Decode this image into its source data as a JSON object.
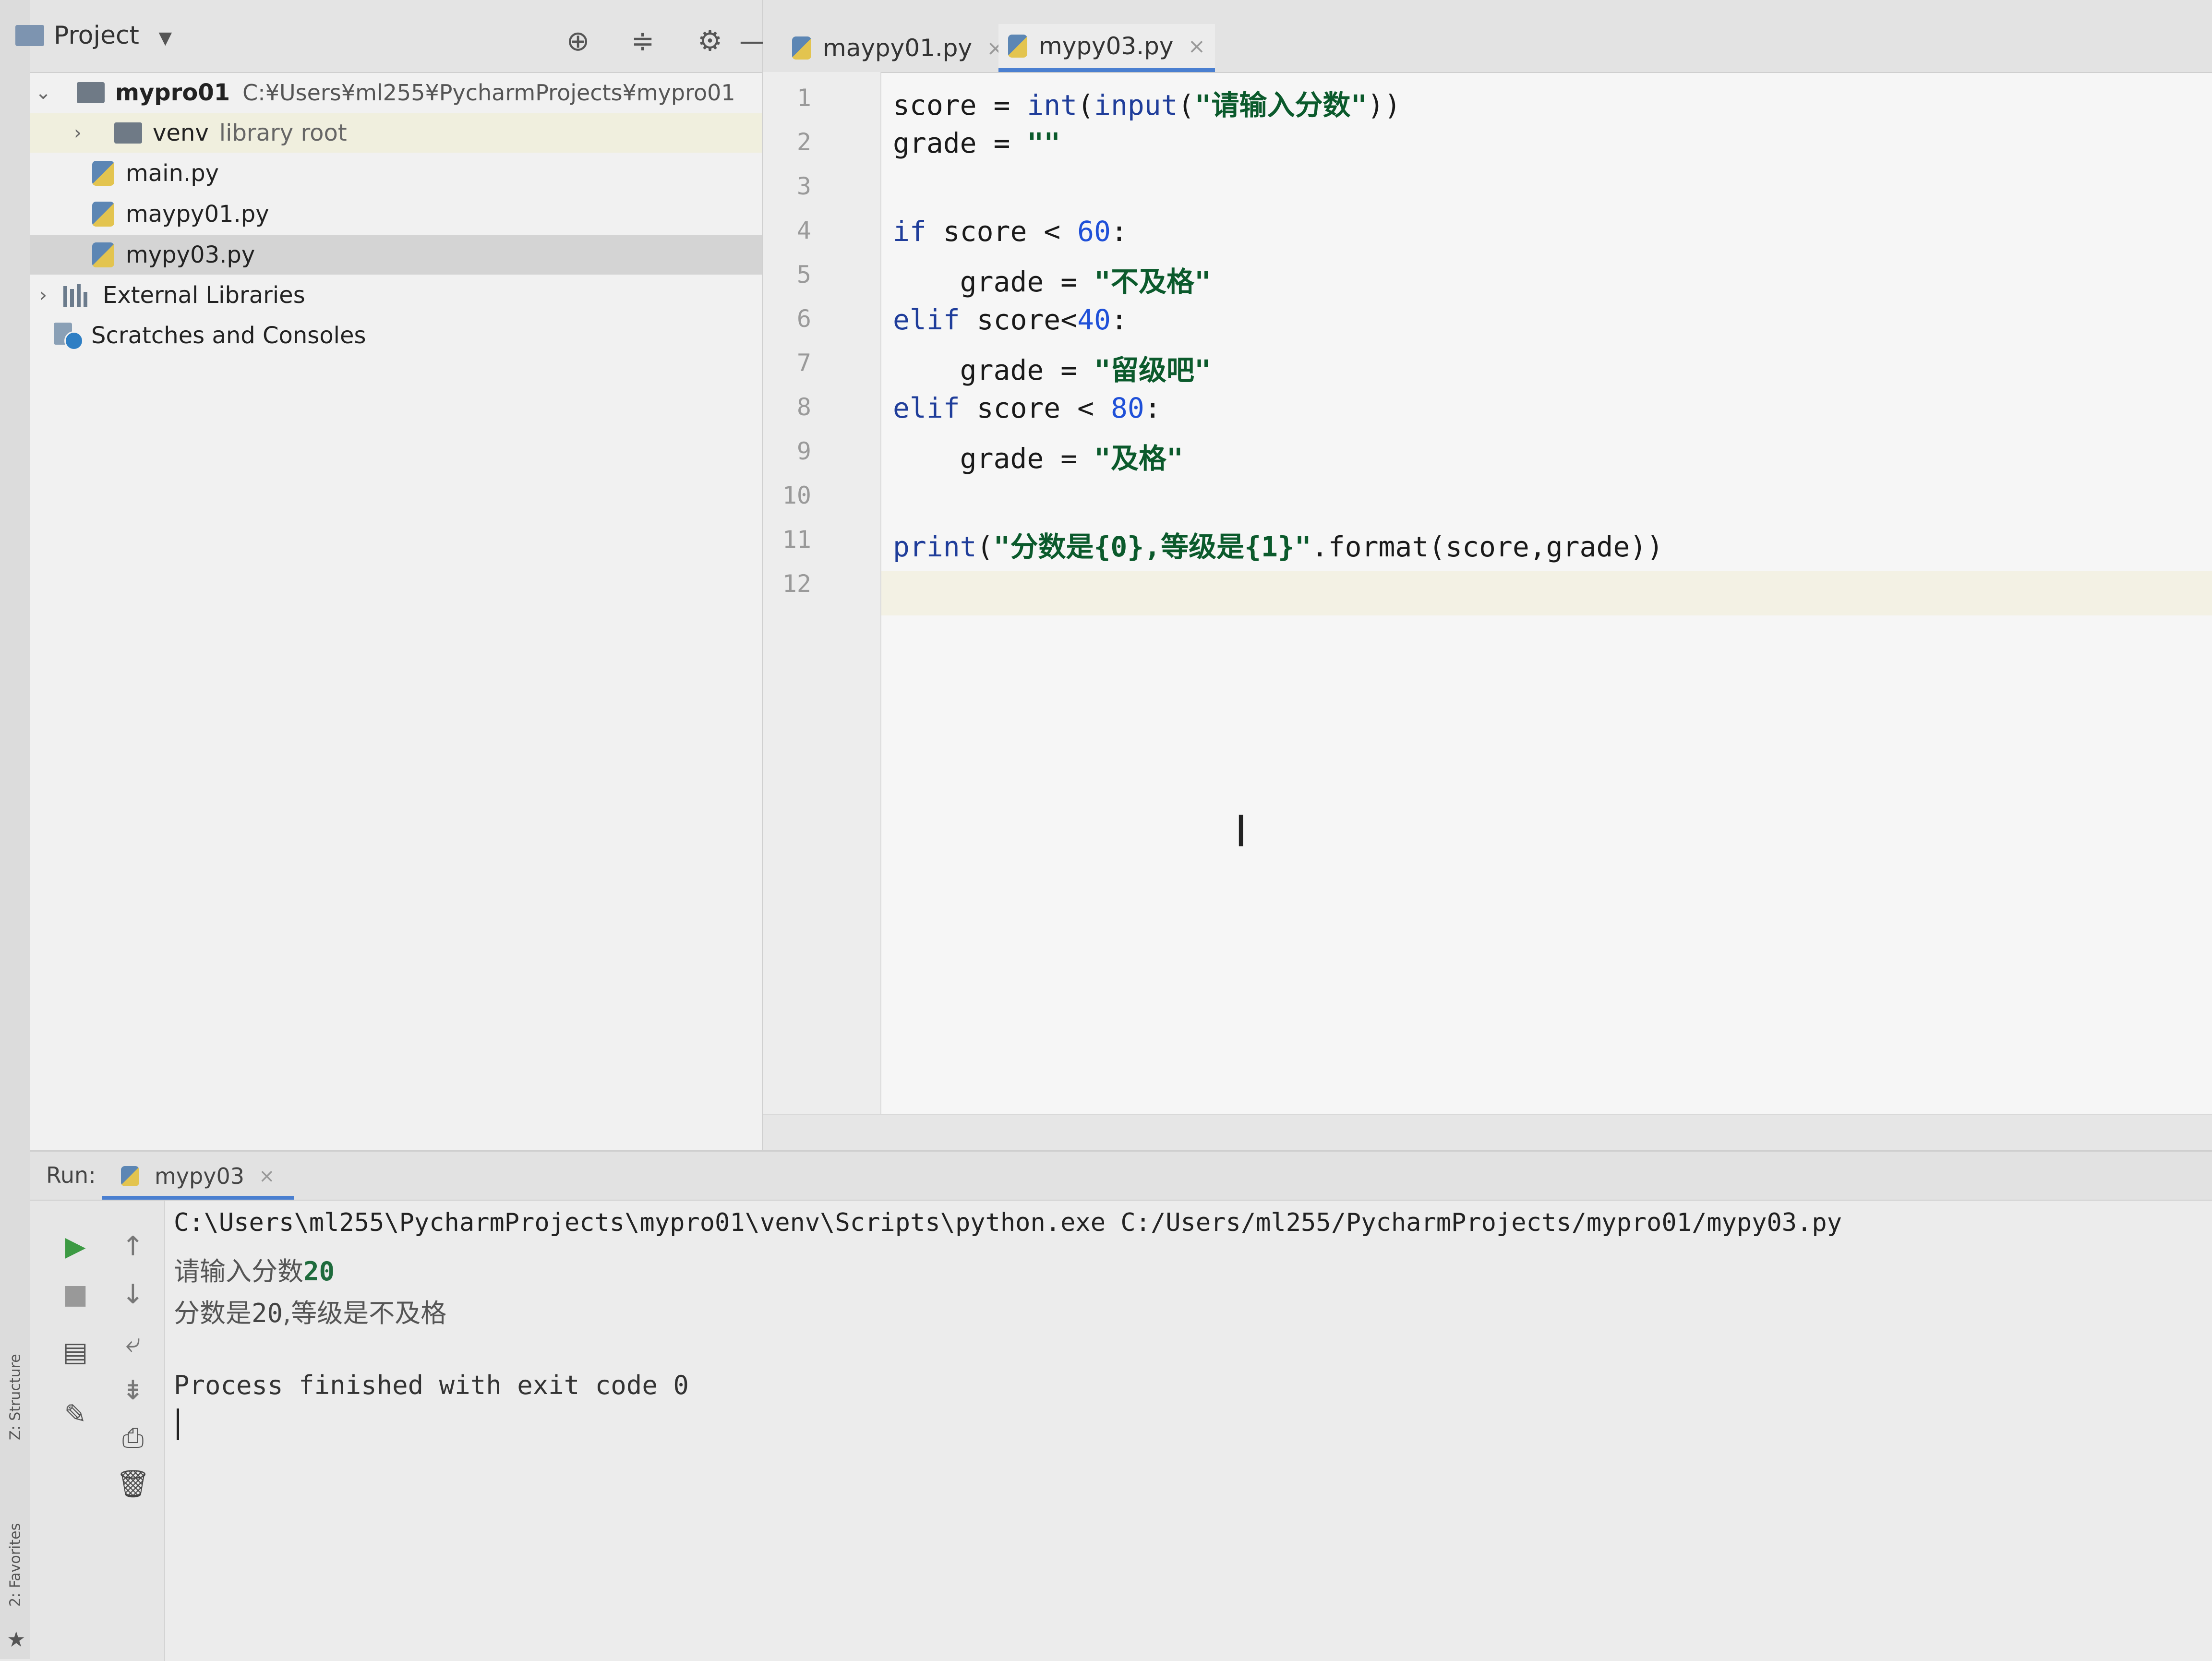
{
  "project_panel": {
    "title": "Project",
    "tree": [
      {
        "name": "mypro01",
        "path": "C:¥Users¥ml255¥PycharmProjects¥mypro01"
      },
      {
        "name": "venv",
        "note": "library root"
      },
      {
        "name": "main.py"
      },
      {
        "name": "maypy01.py"
      },
      {
        "name": "mypy03.py"
      },
      {
        "name": "External Libraries"
      },
      {
        "name": "Scratches and Consoles"
      }
    ]
  },
  "editor": {
    "tabs": [
      {
        "label": "maypy01.py"
      },
      {
        "label": "mypy03.py"
      }
    ],
    "line_numbers": [
      "1",
      "2",
      "3",
      "4",
      "5",
      "6",
      "7",
      "8",
      "9",
      "10",
      "11",
      "12"
    ],
    "code": {
      "l1_a": "score = ",
      "l1_b": "int",
      "l1_c": "(",
      "l1_d": "input",
      "l1_e": "(",
      "l1_f": "\"请输入分数\"",
      "l1_g": "))",
      "l2_a": "grade = ",
      "l2_b": "\"\"",
      "l4_a": "if",
      "l4_b": " score < ",
      "l4_c": "60",
      "l4_d": ":",
      "l5_a": "    grade = ",
      "l5_b": "\"不及格\"",
      "l6_a": "elif",
      "l6_b": " score<",
      "l6_c": "40",
      "l6_d": ":",
      "l7_a": "    grade = ",
      "l7_b": "\"留级吧\"",
      "l8_a": "elif",
      "l8_b": " score < ",
      "l8_c": "80",
      "l8_d": ":",
      "l9_a": "    grade = ",
      "l9_b": "\"及格\"",
      "l11_a": "print",
      "l11_b": "(",
      "l11_c": "\"分数是{0},等级是{1}\"",
      "l11_d": ".format(score,grade))"
    }
  },
  "run_panel": {
    "label": "Run:",
    "tab": "mypy03",
    "console": {
      "command": "C:\\Users\\ml255\\PycharmProjects\\mypro01\\venv\\Scripts\\python.exe C:/Users/ml255/PycharmProjects/mypro01/mypy03.py",
      "prompt_text": "请输入分数",
      "prompt_input": "20",
      "result_a": "分数是",
      "result_b": "20",
      "result_c": ",等级是不及格",
      "finished": "Process finished with exit code 0"
    }
  },
  "side_strip": {
    "structure": "Z: Structure",
    "favorites": "2: Favorites"
  },
  "colors": {
    "keyword": "#1f3d9a",
    "number": "#1f50d8",
    "string": "#0b5a2c",
    "accent": "#4a7fd0"
  }
}
